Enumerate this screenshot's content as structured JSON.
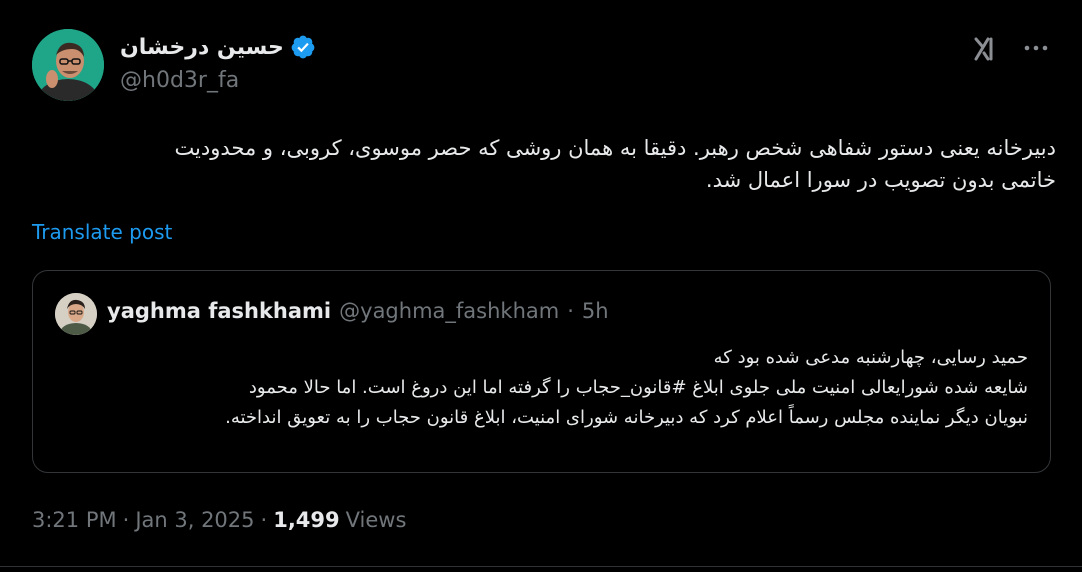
{
  "author": {
    "display_name": "حسین درخشان",
    "handle": "@h0d3r_fa",
    "verified": true,
    "avatar": "avatar-photo"
  },
  "actions": {
    "grok_icon": "grok-icon",
    "more_icon": "more-icon"
  },
  "tweet": {
    "lines": [
      "دبیرخانه یعنی دستور شفاهی شخص رهبر. دقیقا به همان روشی که حصر موسوی، کروبی، و محدودیت",
      "خاتمی بدون تصویب در سورا اعمال شد."
    ]
  },
  "translate_label": "Translate post",
  "quote": {
    "name": "yaghma fashkhami",
    "handle": "@yaghma_fashkham",
    "separator": "·",
    "time": "5h",
    "lines": [
      "حمید رسایی، چهارشنبه مدعی شده بود که",
      "شایعه شده شورایعالی امنیت ملی جلوی ابلاغ #قانون_حجاب را گرفته اما این دروغ است. اما حالا محمود",
      "نبویان دیگر نماینده مجلس رسماً اعلام کرد که دبیرخانه شورای امنیت، ابلاغ قانون حجاب را به تعویق انداخته."
    ]
  },
  "meta": {
    "time": "3:21 PM",
    "sep1": "·",
    "date": "Jan 3, 2025",
    "sep2": "·",
    "views_count": "1,499",
    "views_label": "Views"
  },
  "colors": {
    "background": "#000000",
    "text": "#e7e9ea",
    "secondary": "#71767b",
    "link": "#1d9bf0",
    "border": "#333639"
  }
}
